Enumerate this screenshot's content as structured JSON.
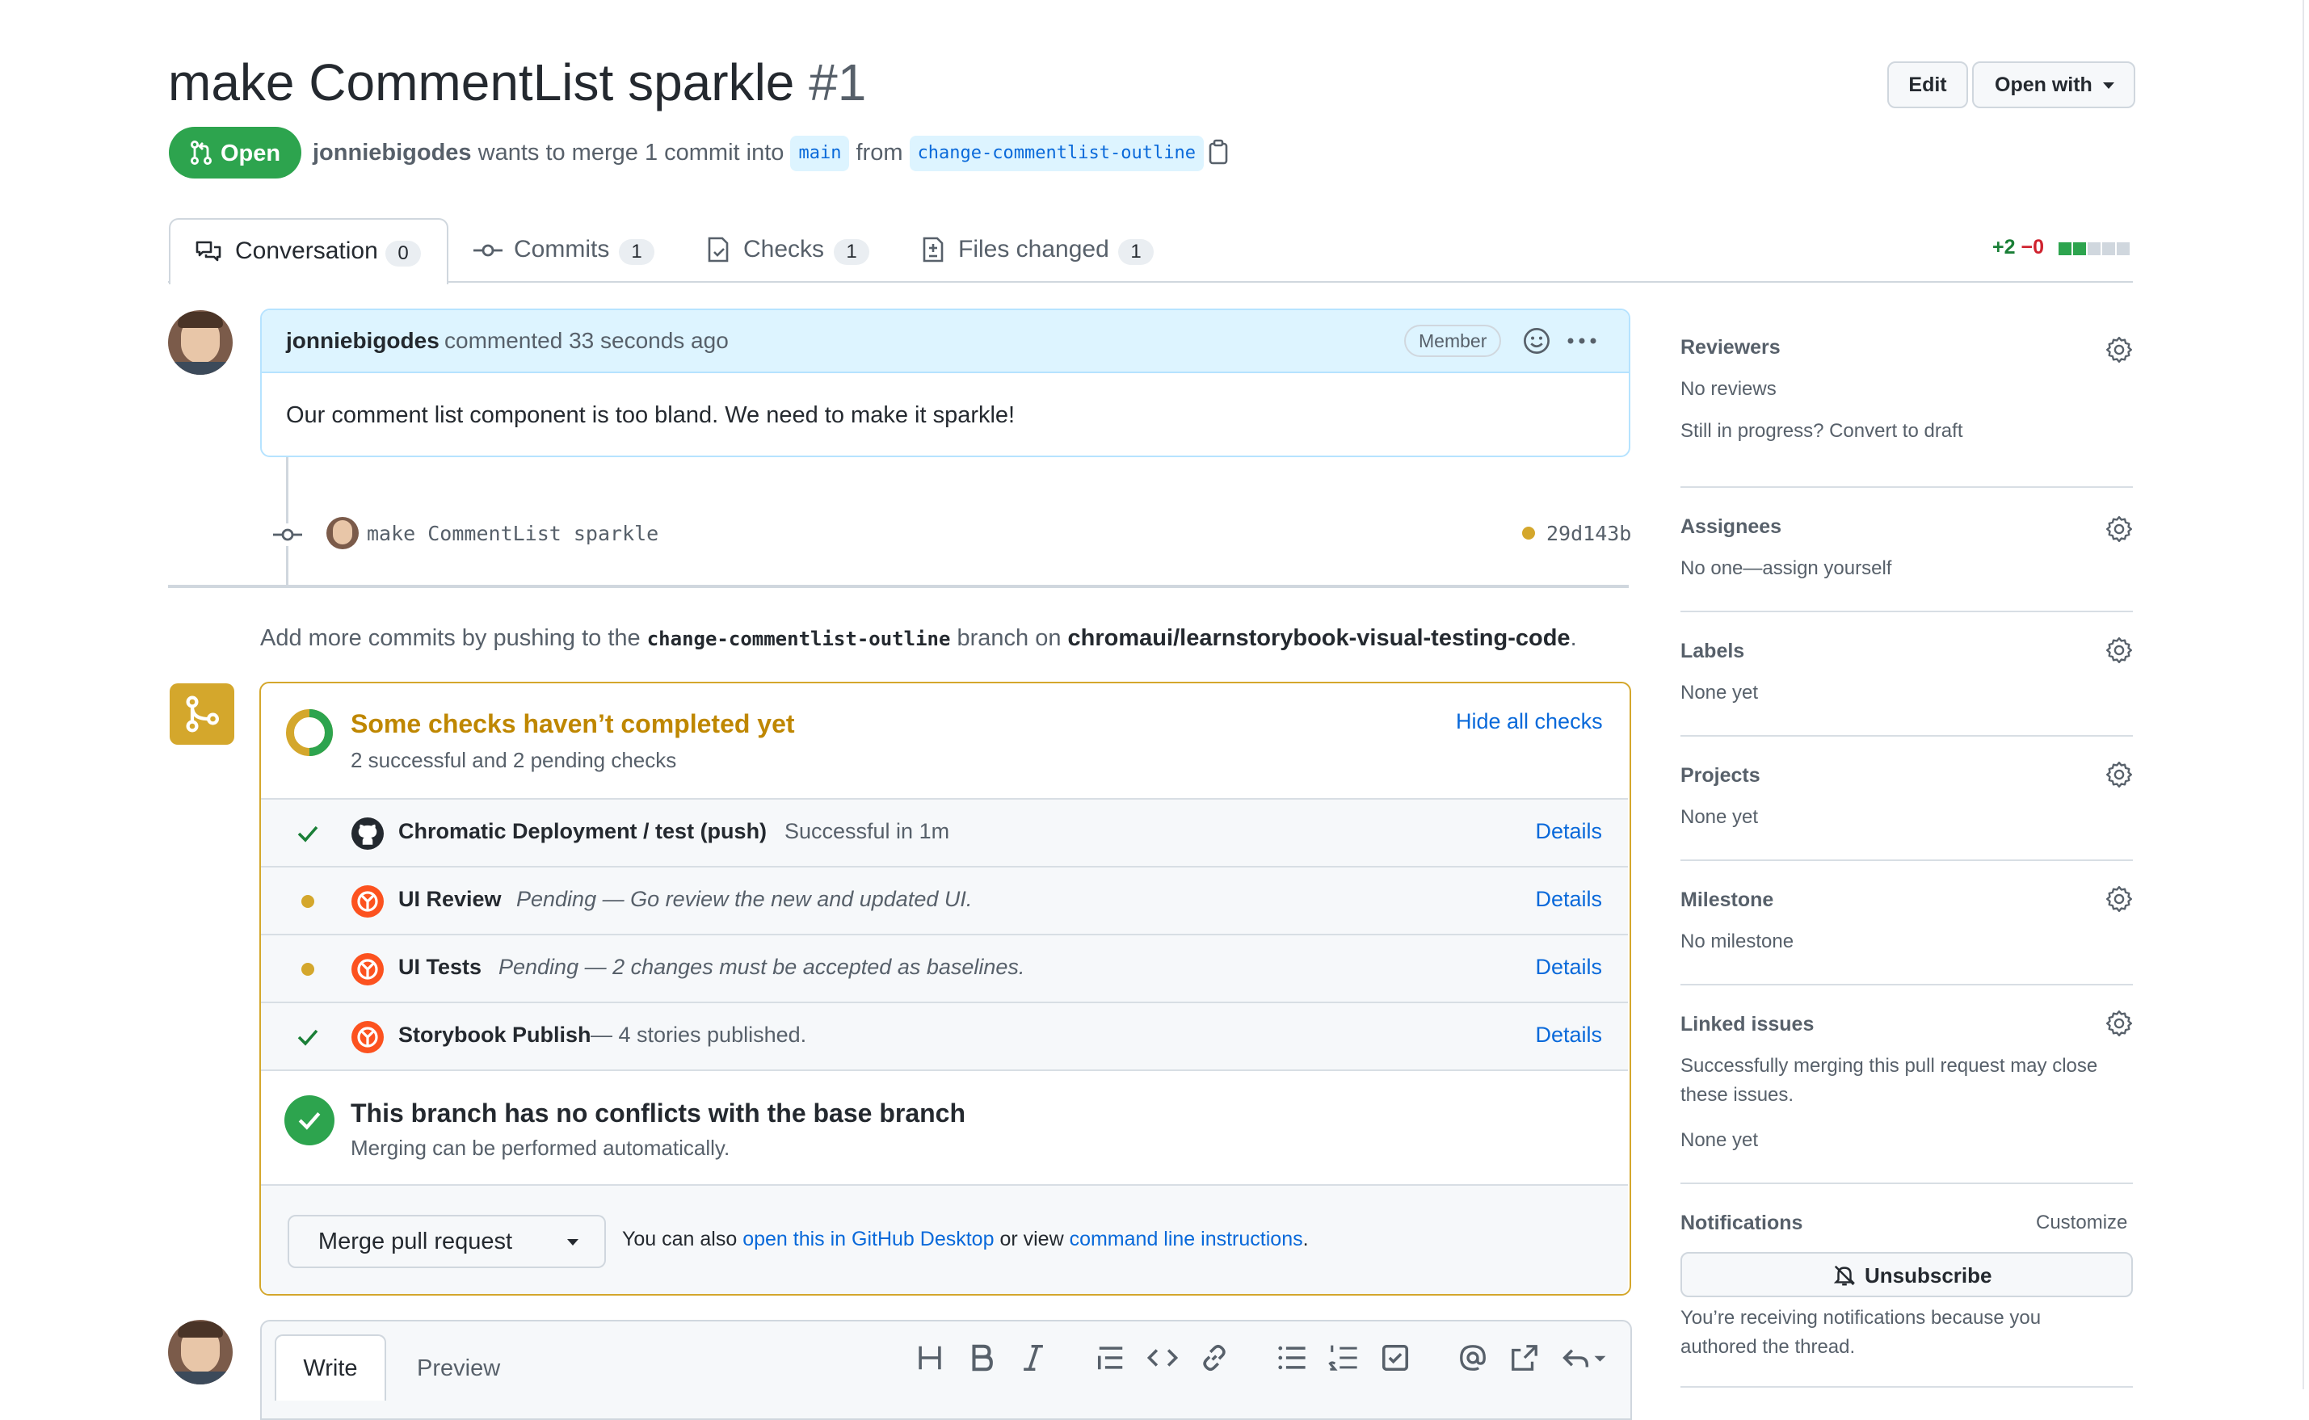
{
  "header": {
    "title": "make CommentList sparkle",
    "number": "#1",
    "edit_label": "Edit",
    "open_with_label": "Open with"
  },
  "status": {
    "state_label": "Open",
    "author": "jonniebigodes",
    "merge_text": "wants to merge 1 commit into",
    "base_branch": "main",
    "from_text": "from",
    "head_branch": "change-commentlist-outline"
  },
  "tabs": [
    {
      "label": "Conversation",
      "count": "0"
    },
    {
      "label": "Commits",
      "count": "1"
    },
    {
      "label": "Checks",
      "count": "1"
    },
    {
      "label": "Files changed",
      "count": "1"
    }
  ],
  "diffstat": {
    "added": "+2",
    "removed": "−0"
  },
  "comment": {
    "author": "jonniebigodes",
    "meta": "commented 33 seconds ago",
    "badge": "Member",
    "body": "Our comment list component is too bland. We need to make it sparkle!"
  },
  "commit": {
    "message": "make CommentList sparkle",
    "sha": "29d143b"
  },
  "push_hint": {
    "prefix": "Add more commits by pushing to the",
    "branch": "change-commentlist-outline",
    "middle": "branch on",
    "repo": "chromaui/learnstorybook-visual-testing-code",
    "suffix": "."
  },
  "checks": {
    "title": "Some checks haven’t completed yet",
    "subtitle": "2 successful and 2 pending checks",
    "hide_label": "Hide all checks",
    "items": [
      {
        "name": "Chromatic Deployment / test (push)",
        "desc": "Successful in 1m",
        "status": "success",
        "icon": "github-icon",
        "details": "Details"
      },
      {
        "name": "UI Review",
        "desc": "Pending — Go review the new and updated UI.",
        "status": "pending",
        "icon": "chromatic-icon",
        "details": "Details"
      },
      {
        "name": "UI Tests",
        "desc": "Pending — 2 changes must be accepted as baselines.",
        "status": "pending",
        "icon": "chromatic-icon",
        "details": "Details"
      },
      {
        "name": "Storybook Publish",
        "desc": "— 4 stories published.",
        "status": "success",
        "icon": "chromatic-icon",
        "details": "Details"
      }
    ]
  },
  "merge": {
    "title": "This branch has no conflicts with the base branch",
    "subtitle": "Merging can be performed automatically.",
    "button_label": "Merge pull request",
    "alt_prefix": "You can also",
    "desktop_link": "open this in GitHub Desktop",
    "alt_middle": "or view",
    "cli_link": "command line instructions",
    "alt_suffix": "."
  },
  "editor": {
    "write_tab": "Write",
    "preview_tab": "Preview"
  },
  "sidebar": {
    "reviewers": {
      "title": "Reviewers",
      "line1": "No reviews",
      "line2": "Still in progress? Convert to draft"
    },
    "assignees": {
      "title": "Assignees",
      "line1": "No one—assign yourself"
    },
    "labels": {
      "title": "Labels",
      "line1": "None yet"
    },
    "projects": {
      "title": "Projects",
      "line1": "None yet"
    },
    "milestone": {
      "title": "Milestone",
      "line1": "No milestone"
    },
    "linked_issues": {
      "title": "Linked issues",
      "line1": "Successfully merging this pull request may close",
      "line2": "these issues.",
      "line3": "None yet"
    },
    "notifications": {
      "title": "Notifications",
      "customize": "Customize",
      "button_label": "Unsubscribe",
      "line1": "You’re receiving notifications because you",
      "line2": "authored the thread."
    }
  },
  "colors": {
    "open_green": "#2da44e",
    "pending_yellow": "#bf8700",
    "pending_dot": "#d4a72c",
    "success_green": "#1a7f37",
    "link_blue": "#0969da",
    "chromatic_orange": "#fc521f"
  }
}
